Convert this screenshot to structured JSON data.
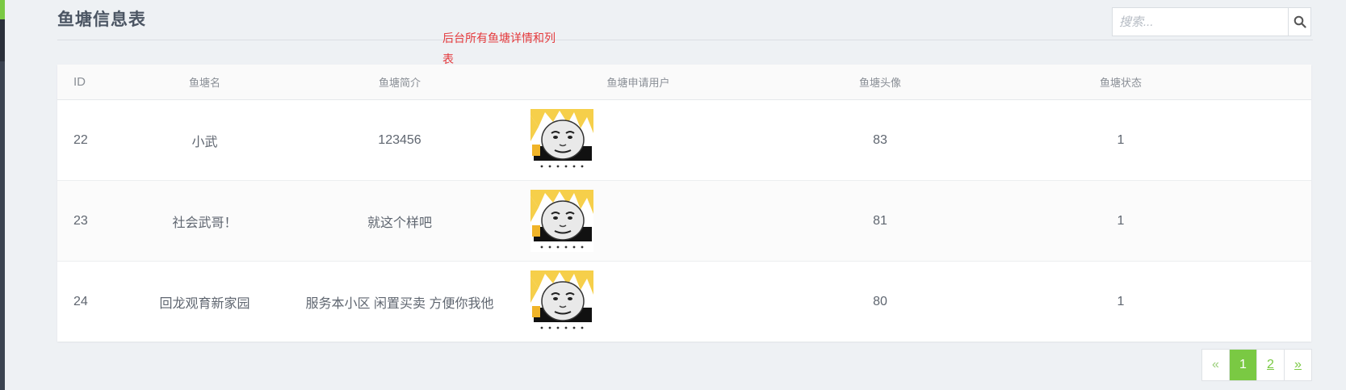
{
  "page": {
    "title": "鱼塘信息表",
    "note": "后台所有鱼塘详情和列表"
  },
  "search": {
    "placeholder": "搜索..."
  },
  "table": {
    "columns": [
      "ID",
      "鱼塘名",
      "鱼塘简介",
      "鱼塘申请用户",
      "鱼塘头像",
      "鱼塘状态"
    ],
    "rows": [
      {
        "id": "22",
        "name": "小武",
        "desc": "123456",
        "user_avatar": "meme-face",
        "head": "83",
        "status": "1"
      },
      {
        "id": "23",
        "name": "社会武哥！",
        "desc": "就这个样吧",
        "user_avatar": "meme-face",
        "head": "81",
        "status": "1"
      },
      {
        "id": "24",
        "name": "回龙观育新家园",
        "desc": "服务本小区 闲置买卖 方便你我他",
        "user_avatar": "meme-face",
        "head": "80",
        "status": "1"
      }
    ]
  },
  "pagination": {
    "prev": "«",
    "pages": [
      "1",
      "2"
    ],
    "current": "1",
    "next": "»"
  },
  "colors": {
    "accent": "#7ac943",
    "note": "#e4393c",
    "sidebar": "#3b4350"
  }
}
